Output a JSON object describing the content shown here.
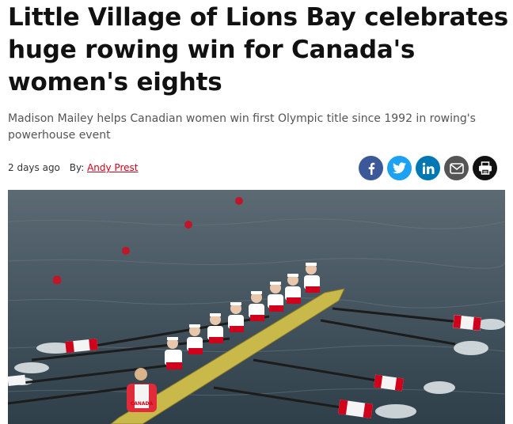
{
  "article": {
    "headline": "Little Village of Lions Bay celebrates huge rowing win for Canada's women's eights",
    "subheadline": "Madison Mailey helps Canadian women win first Olympic title since 1992 in rowing's powerhouse event",
    "timestamp": "2 days ago",
    "byline_prefix": "By:",
    "author": "Andy Prest"
  },
  "share": {
    "buttons": [
      {
        "icon": "facebook-icon",
        "color": "#3b5998"
      },
      {
        "icon": "twitter-icon",
        "color": "#1da1f2"
      },
      {
        "icon": "linkedin-icon",
        "color": "#0077b5"
      },
      {
        "icon": "email-icon",
        "color": "#555555"
      },
      {
        "icon": "print-icon",
        "color": "#111111"
      }
    ]
  },
  "photo": {
    "shirt_text": "CANADA"
  },
  "colors": {
    "accent": "#d0021b",
    "water": "#3a4a56",
    "boat": "#c9b84a"
  }
}
